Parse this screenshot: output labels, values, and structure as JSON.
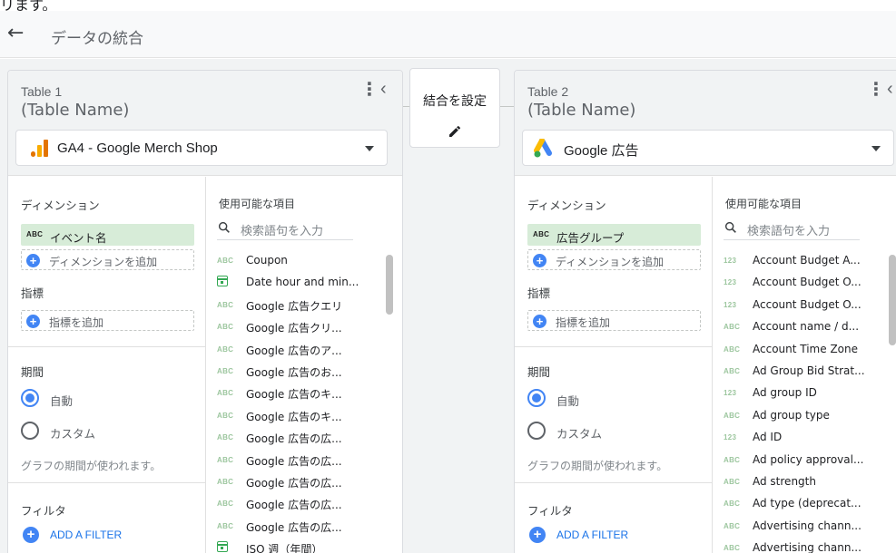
{
  "top_cut_text": "リます。",
  "header": {
    "back_icon": "arrow-left-icon",
    "title": "データの統合"
  },
  "join": {
    "label": "結合を設定",
    "icon": "pencil-icon"
  },
  "tables": [
    {
      "title": "Table 1",
      "name": "(Table Name)",
      "source": "GA4 - Google Merch Shop",
      "source_icon": "google-analytics-icon",
      "dimensions_label": "ディメンション",
      "dimension_chip": {
        "type": "ABC",
        "label": "イベント名"
      },
      "add_dimension": "ディメンションを追加",
      "metrics_label": "指標",
      "add_metric": "指標を追加",
      "period_label": "期間",
      "period_auto": "自動",
      "period_custom": "カスタム",
      "period_hint": "グラフの期間が使われます。",
      "filter_label": "フィルタ",
      "add_filter": "ADD A FILTER",
      "fields_title": "使用可能な項目",
      "search_placeholder": "検索語句を入力",
      "fields": [
        {
          "type": "ABC",
          "name": "Coupon"
        },
        {
          "type": "date",
          "name": "Date hour and min..."
        },
        {
          "type": "ABC",
          "name": "Google 広告クエリ"
        },
        {
          "type": "ABC",
          "name": "Google 広告クリ..."
        },
        {
          "type": "ABC",
          "name": "Google 広告のア..."
        },
        {
          "type": "ABC",
          "name": "Google 広告のお..."
        },
        {
          "type": "ABC",
          "name": "Google 広告のキ..."
        },
        {
          "type": "ABC",
          "name": "Google 広告のキ..."
        },
        {
          "type": "ABC",
          "name": "Google 広告の広..."
        },
        {
          "type": "ABC",
          "name": "Google 広告の広..."
        },
        {
          "type": "ABC",
          "name": "Google 広告の広..."
        },
        {
          "type": "ABC",
          "name": "Google 広告の広..."
        },
        {
          "type": "ABC",
          "name": "Google 広告の広..."
        },
        {
          "type": "date",
          "name": "ISO 週（年間）"
        }
      ]
    },
    {
      "title": "Table 2",
      "name": "(Table Name)",
      "source": "Google 広告",
      "source_icon": "google-ads-icon",
      "dimensions_label": "ディメンション",
      "dimension_chip": {
        "type": "ABC",
        "label": "広告グループ"
      },
      "add_dimension": "ディメンションを追加",
      "metrics_label": "指標",
      "add_metric": "指標を追加",
      "period_label": "期間",
      "period_auto": "自動",
      "period_custom": "カスタム",
      "period_hint": "グラフの期間が使われます。",
      "filter_label": "フィルタ",
      "add_filter": "ADD A FILTER",
      "fields_title": "使用可能な項目",
      "search_placeholder": "検索語句を入力",
      "fields": [
        {
          "type": "123",
          "name": "Account Budget A..."
        },
        {
          "type": "123",
          "name": "Account Budget O..."
        },
        {
          "type": "123",
          "name": "Account Budget O..."
        },
        {
          "type": "ABC",
          "name": "Account name / d..."
        },
        {
          "type": "ABC",
          "name": "Account Time Zone"
        },
        {
          "type": "ABC",
          "name": "Ad Group Bid Strat..."
        },
        {
          "type": "123",
          "name": "Ad group ID"
        },
        {
          "type": "ABC",
          "name": "Ad group type"
        },
        {
          "type": "123",
          "name": "Ad ID"
        },
        {
          "type": "ABC",
          "name": "Ad policy approval..."
        },
        {
          "type": "ABC",
          "name": "Ad strength"
        },
        {
          "type": "ABC",
          "name": "Ad type (deprecat..."
        },
        {
          "type": "ABC",
          "name": "Advertising chann..."
        },
        {
          "type": "ABC",
          "name": "Advertising chann..."
        }
      ]
    }
  ],
  "colors": {
    "accent": "#4285f4",
    "chip": "#d7ecd8",
    "link": "#1a73e8"
  }
}
